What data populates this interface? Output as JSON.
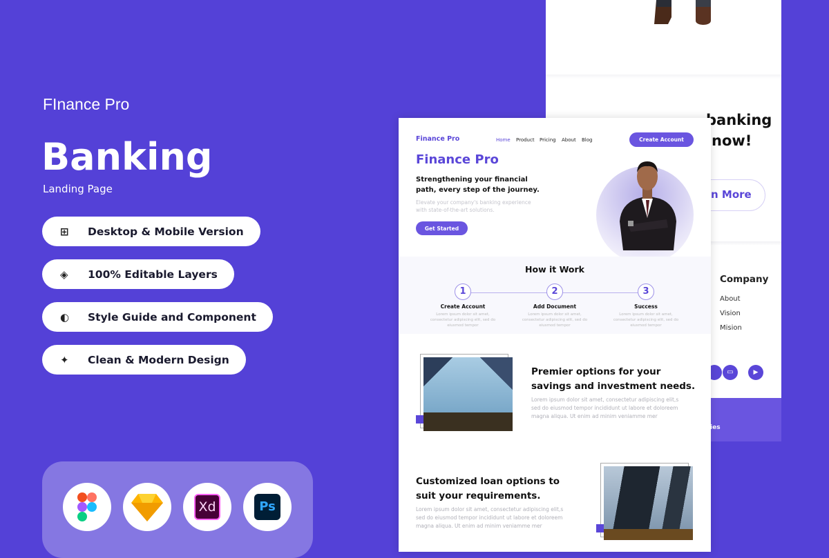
{
  "promo": {
    "brand": "FInance Pro",
    "title": "Banking",
    "subtitle": "Landing Page",
    "features": [
      {
        "icon": "grid-icon",
        "label": "Desktop & Mobile Version"
      },
      {
        "icon": "layers-icon",
        "label": "100% Editable Layers"
      },
      {
        "icon": "palette-icon",
        "label": "Style Guide and Component"
      },
      {
        "icon": "sparkle-icon",
        "label": "Clean & Modern Design"
      }
    ],
    "tools": [
      "figma-icon",
      "sketch-icon",
      "xd-icon",
      "photoshop-icon"
    ],
    "xd": "Xd",
    "ps": "Ps"
  },
  "colors": {
    "background": "#5441d7",
    "accent": "#6a55e0"
  },
  "back_page": {
    "cta_line1": "banking",
    "cta_line2": "now!",
    "learn_more": "n More",
    "company_title": "Company",
    "company_links": [
      "About",
      "Vision",
      "Mision"
    ],
    "footer_text": "ies"
  },
  "front_page": {
    "logo": "Finance Pro",
    "nav": [
      "Home",
      "Product",
      "Pricing",
      "About",
      "Blog"
    ],
    "create_account": "Create Account",
    "hero": {
      "title": "Finance Pro",
      "headline": "Strengthening your financial path, every step of the journey.",
      "text": "Elevate your company's banking experience with state-of-the-art solutions.",
      "cta": "Get Started"
    },
    "how": {
      "title": "How it Work",
      "steps": [
        {
          "num": "1",
          "title": "Create Account",
          "text": "Lorem ipsum dolor sit amet, consectetur adipiscing elit, sed do eiusmod tempor"
        },
        {
          "num": "2",
          "title": "Add Document",
          "text": "Lorem ipsum dolor sit amet, consectetur adipiscing elit, sed do eiusmod tempor"
        },
        {
          "num": "3",
          "title": "Success",
          "text": "Lorem ipsum dolor sit amet, consectetur adipiscing elit, sed do eiusmod tempor"
        }
      ]
    },
    "feature1": {
      "title": "Premier options for your savings and investment needs.",
      "text": "Lorem ipsum dolor sit amet, consectetur adipiscing elit,s sed do eiusmod tempor incididunt ut labore et doloreem magna aliqua. Ut enim ad minim veniamme mer"
    },
    "feature2": {
      "title": "Customized loan options to suit your requirements.",
      "text": "Lorem ipsum dolor sit amet, consectetur adipiscing elit,s sed do eiusmod tempor incididunt ut labore et doloreem magna aliqua. Ut enim ad minim veniamme mer"
    }
  }
}
